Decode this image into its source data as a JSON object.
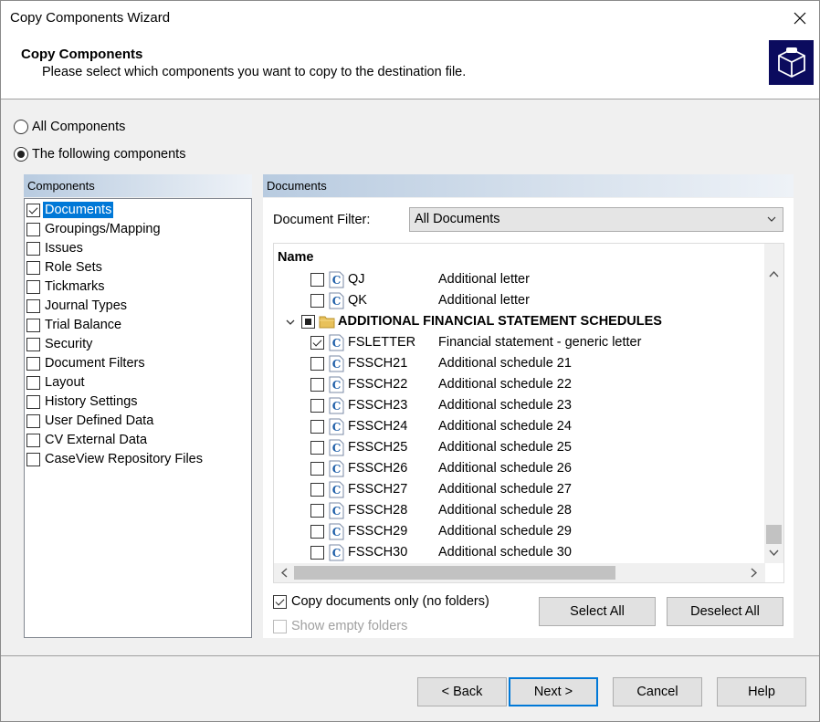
{
  "window": {
    "title": "Copy Components Wizard"
  },
  "header": {
    "title": "Copy Components",
    "subtitle": "Please select which components you want to copy to the destination file.",
    "logo_icon": "cube-icon",
    "logo_bg": "#0b0b5e"
  },
  "scope": {
    "all_label": "All Components",
    "following_label": "The following components",
    "selected": "following"
  },
  "components": {
    "header": "Components",
    "items": [
      {
        "label": "Documents",
        "checked": true,
        "selected": true
      },
      {
        "label": "Groupings/Mapping",
        "checked": false
      },
      {
        "label": "Issues",
        "checked": false
      },
      {
        "label": "Role Sets",
        "checked": false
      },
      {
        "label": "Tickmarks",
        "checked": false
      },
      {
        "label": "Journal Types",
        "checked": false
      },
      {
        "label": "Trial Balance",
        "checked": false
      },
      {
        "label": "Security",
        "checked": false
      },
      {
        "label": "Document Filters",
        "checked": false
      },
      {
        "label": "Layout",
        "checked": false
      },
      {
        "label": "History Settings",
        "checked": false
      },
      {
        "label": "User Defined Data",
        "checked": false
      },
      {
        "label": "CV External Data",
        "checked": false
      },
      {
        "label": "CaseView Repository Files",
        "checked": false
      }
    ]
  },
  "documents": {
    "header": "Documents",
    "filter_label": "Document Filter:",
    "filter_value": "All Documents",
    "column_name": "Name",
    "rows": [
      {
        "name": "QJ",
        "desc": "Additional letter",
        "checked": false,
        "type": "doc"
      },
      {
        "name": "QK",
        "desc": "Additional letter",
        "checked": false,
        "type": "doc"
      },
      {
        "name": "ADDITIONAL FINANCIAL STATEMENT SCHEDULES",
        "desc": "",
        "checked": "partial",
        "type": "folder"
      },
      {
        "name": "FSLETTER",
        "desc": "Financial statement - generic letter",
        "checked": true,
        "type": "doc"
      },
      {
        "name": "FSSCH21",
        "desc": "Additional schedule 21",
        "checked": false,
        "type": "doc"
      },
      {
        "name": "FSSCH22",
        "desc": "Additional schedule 22",
        "checked": false,
        "type": "doc"
      },
      {
        "name": "FSSCH23",
        "desc": "Additional schedule 23",
        "checked": false,
        "type": "doc"
      },
      {
        "name": "FSSCH24",
        "desc": "Additional schedule 24",
        "checked": false,
        "type": "doc"
      },
      {
        "name": "FSSCH25",
        "desc": "Additional schedule 25",
        "checked": false,
        "type": "doc"
      },
      {
        "name": "FSSCH26",
        "desc": "Additional schedule 26",
        "checked": false,
        "type": "doc"
      },
      {
        "name": "FSSCH27",
        "desc": "Additional schedule 27",
        "checked": false,
        "type": "doc"
      },
      {
        "name": "FSSCH28",
        "desc": "Additional schedule 28",
        "checked": false,
        "type": "doc"
      },
      {
        "name": "FSSCH29",
        "desc": "Additional schedule 29",
        "checked": false,
        "type": "doc"
      },
      {
        "name": "FSSCH30",
        "desc": "Additional schedule 30",
        "checked": false,
        "type": "doc"
      }
    ],
    "copy_docs_only_label": "Copy documents only (no folders)",
    "copy_docs_only_checked": true,
    "show_empty_label": "Show empty folders",
    "show_empty_checked": false,
    "select_all_label": "Select All",
    "deselect_all_label": "Deselect All"
  },
  "footer": {
    "back_label": "< Back",
    "next_label": "Next >",
    "cancel_label": "Cancel",
    "help_label": "Help"
  },
  "colors": {
    "selection": "#0078d7",
    "pane_header_start": "#b8cbe0",
    "doc_icon": "#1f5fa8"
  }
}
